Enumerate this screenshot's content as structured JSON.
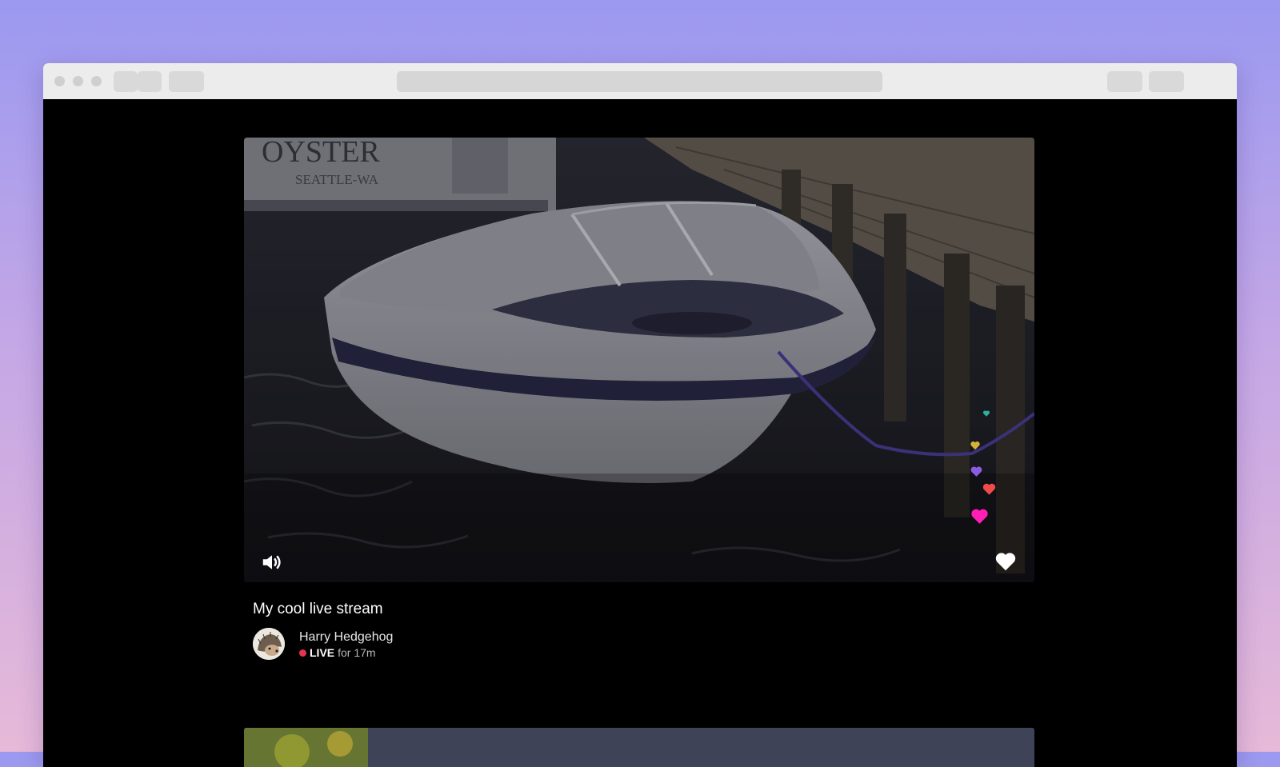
{
  "stream": {
    "title": "My cool live stream",
    "streamer_name": "Harry Hedgehog",
    "live_label": "LIVE",
    "live_duration": "for 17m",
    "video_text": {
      "boat_name": "OYSTER",
      "boat_home": "SEATTLE-WA"
    }
  },
  "player": {
    "volume_icon": "speaker-volume-icon",
    "like_icon": "heart-icon",
    "reaction_colors": [
      "#2ab09b",
      "#d4b13a",
      "#8c5ce0",
      "#f04b4b",
      "#ff1fb4"
    ]
  },
  "colors": {
    "live": "#e8344e"
  }
}
